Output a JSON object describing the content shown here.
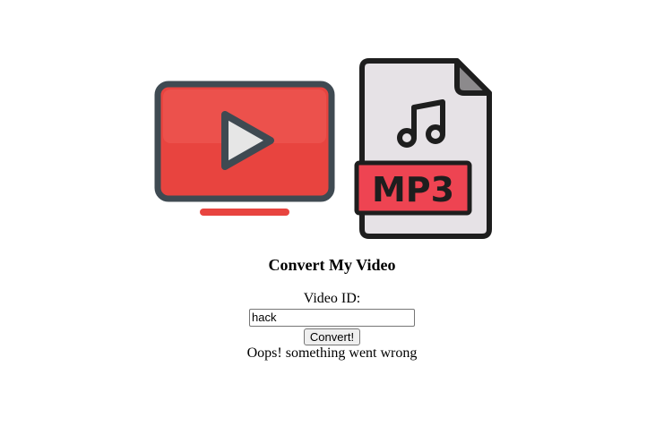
{
  "logo": {
    "tv_icon": "youtube-tv-icon",
    "file_icon": "mp3-file-icon",
    "file_label": "MP3"
  },
  "heading": "Convert My Video",
  "form": {
    "label": "Video ID:",
    "input_value": "hack",
    "button_label": "Convert!"
  },
  "status_message": "Oops! something went wrong",
  "colors": {
    "red": "#e8443f",
    "outline": "#3f4a52",
    "paper": "#e6e2e6"
  }
}
